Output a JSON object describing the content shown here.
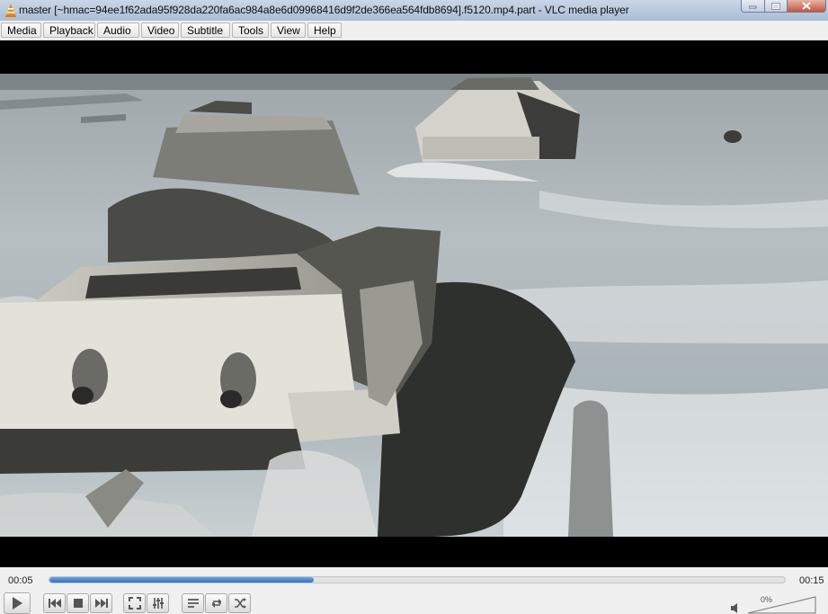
{
  "window": {
    "title": "master [~hmac=94ee1f62ada95f928da220fa6ac984a8e6d09968416d9f2de366ea564fdb8694].f5120.mp4.part - VLC media player"
  },
  "menu": {
    "items": [
      {
        "label": "Media"
      },
      {
        "label": "Playback"
      },
      {
        "label": "Audio"
      },
      {
        "label": "Video"
      },
      {
        "label": "Subtitle"
      },
      {
        "label": "Tools"
      },
      {
        "label": "View"
      },
      {
        "label": "Help"
      }
    ]
  },
  "playback": {
    "elapsed": "00:05",
    "total": "00:15",
    "progress": 0.36,
    "volume_label": "0%"
  },
  "colors": {
    "accent": "#2e73c4",
    "titlebar": "#b4c5db"
  }
}
